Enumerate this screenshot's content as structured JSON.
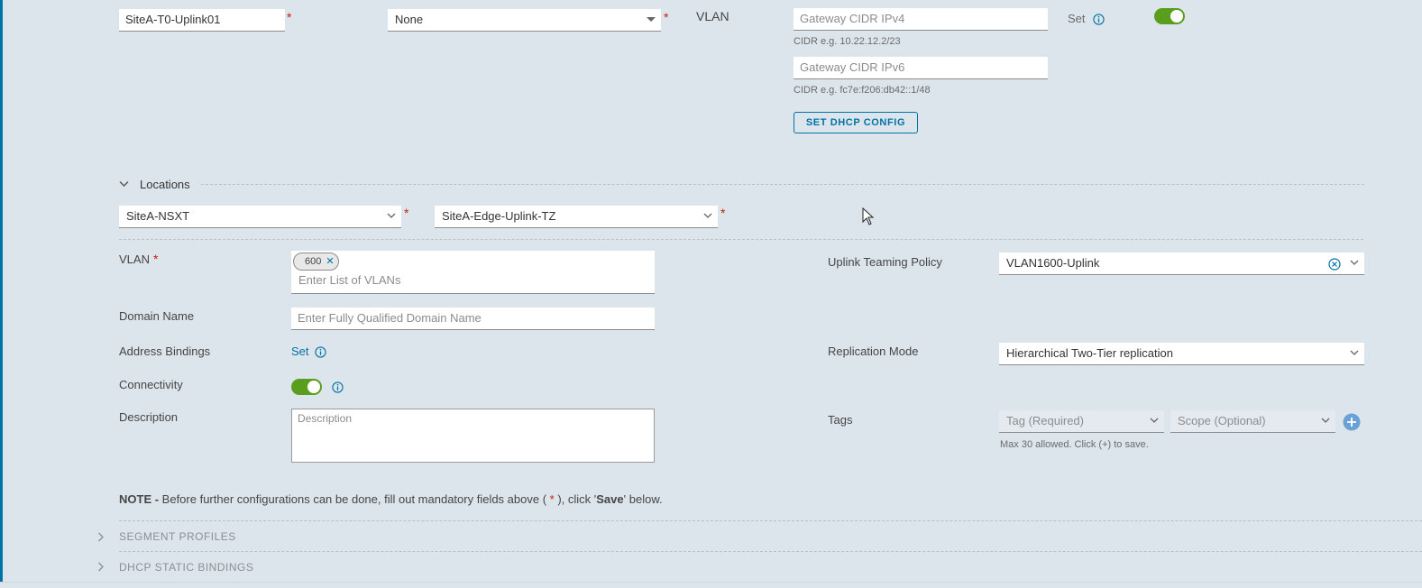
{
  "top_row": {
    "name_value": "SiteA-T0-Uplink01",
    "connected_gateway_value": "None",
    "type_value": "VLAN",
    "gateway_ipv4_placeholder": "Gateway CIDR IPv4",
    "ipv4_hint": "CIDR e.g. 10.22.12.2/23",
    "gateway_ipv6_placeholder": "Gateway CIDR IPv6",
    "ipv6_hint": "CIDR e.g. fc7e:f206:db42::1/48",
    "dhcp_button_label": "SET DHCP CONFIG",
    "set_label": "Set",
    "required_mark": "*"
  },
  "locations": {
    "header": "Locations",
    "site_value": "SiteA-NSXT",
    "transport_zone_value": "SiteA-Edge-Uplink-TZ"
  },
  "form": {
    "vlan_label": "VLAN",
    "vlan_tag": "600",
    "vlan_tag_close": "✕",
    "vlan_placeholder": "Enter List of VLANs",
    "domain_label": "Domain Name",
    "domain_placeholder": "Enter Fully Qualified Domain Name",
    "address_bindings_label": "Address Bindings",
    "address_bindings_link": "Set",
    "connectivity_label": "Connectivity",
    "description_label": "Description",
    "description_placeholder": "Description",
    "uplink_teaming_label": "Uplink Teaming Policy",
    "uplink_teaming_value": "VLAN1600-Uplink",
    "replication_label": "Replication Mode",
    "replication_value": "Hierarchical Two-Tier replication",
    "tags_label": "Tags",
    "tag_placeholder": "Tag (Required)",
    "scope_placeholder": "Scope (Optional)",
    "tags_hint": "Max 30 allowed. Click (+) to save."
  },
  "note": {
    "prefix": "NOTE -",
    "text_before": " Before further configurations can be done, fill out mandatory fields above ( ",
    "asterisk": "*",
    "text_middle": " ), click '",
    "save_word": "Save",
    "text_after": "' below."
  },
  "sections": {
    "segment_profiles": "SEGMENT PROFILES",
    "dhcp_static_bindings": "DHCP STATIC BINDINGS"
  },
  "colors": {
    "accent": "#0072a3",
    "toggle_on": "#5a9e1e",
    "required": "#c92100",
    "background": "#dde5ec"
  }
}
